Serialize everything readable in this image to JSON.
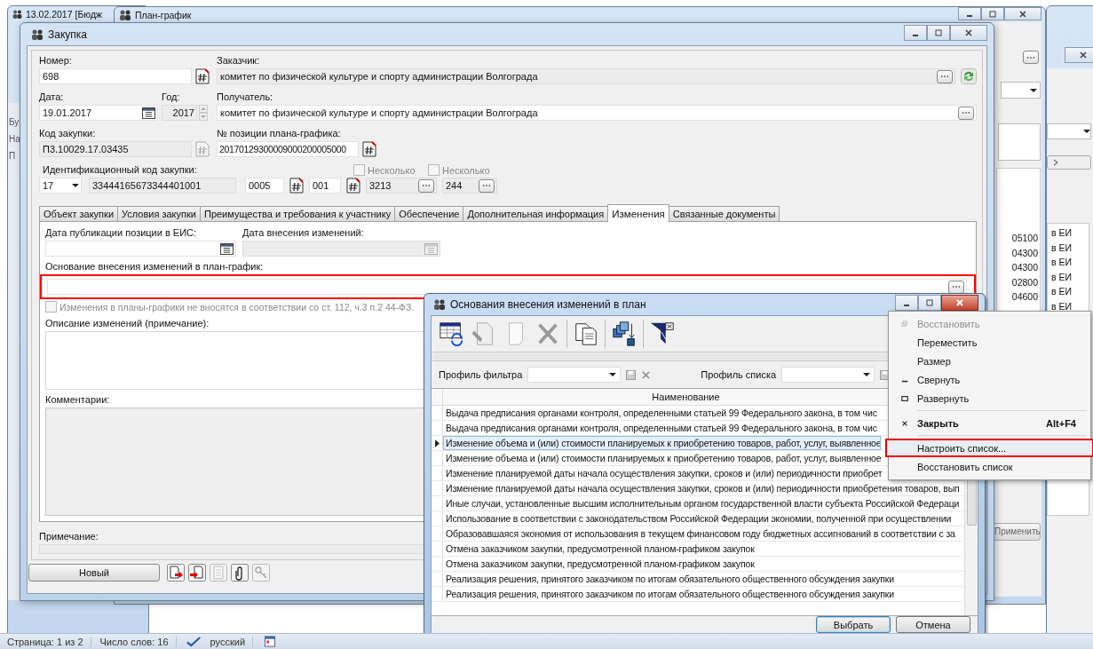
{
  "background": {
    "windows": [
      {
        "title": "13.02.2017 [Бюдж"
      },
      {
        "title": "План-график"
      }
    ],
    "side_labels": [
      "Бу",
      "На",
      "П"
    ],
    "codes": [
      "05100",
      "04300",
      "04300",
      "02800",
      "04600"
    ],
    "eis": [
      "в ЕИ",
      "в ЕИ",
      "в ЕИ",
      "в ЕИ",
      "в ЕИ",
      "в ЕИ"
    ],
    "apply_button": "Применить"
  },
  "main": {
    "title": "Закупка",
    "number": {
      "label": "Номер:",
      "value": "698"
    },
    "customer": {
      "label": "Заказчик:",
      "value": "комитет по физической культуре и спорту администрации Волгограда"
    },
    "date": {
      "label": "Дата:",
      "value": "19.01.2017"
    },
    "year": {
      "label": "Год:",
      "value": "2017"
    },
    "recipient": {
      "label": "Получатель:",
      "value": "комитет по физической культуре и спорту администрации Волгограда"
    },
    "code": {
      "label": "Код закупки:",
      "value": "П3.10029.17.03435"
    },
    "position": {
      "label": "№ позиции плана-графика:",
      "value": "20170129300009000200005000"
    },
    "id_code": {
      "label": "Идентификационный код закупки:",
      "prefix": "17",
      "inn": "33444165673344401001",
      "parts": [
        "0005",
        "001"
      ],
      "several": [
        {
          "label": "Несколько",
          "checked": false,
          "disabled": true,
          "value": "3213"
        },
        {
          "label": "Несколько",
          "checked": false,
          "disabled": true,
          "value": "244"
        }
      ]
    },
    "tabs": [
      {
        "label": "Объект закупки",
        "selected": false
      },
      {
        "label": "Условия закупки",
        "selected": false
      },
      {
        "label": "Преимущества и требования к участнику",
        "selected": false
      },
      {
        "label": "Обеспечение",
        "selected": false
      },
      {
        "label": "Дополнительная информация",
        "selected": false
      },
      {
        "label": "Изменения",
        "selected": true
      },
      {
        "label": "Связанные документы",
        "selected": false
      }
    ],
    "changes": {
      "pub_date_label": "Дата публикации позиции в ЕИС:",
      "change_date_label": "Дата внесения изменений:",
      "basis_label": "Основание внесения изменений в план-график:",
      "basis_highlighted": true,
      "not_applied": {
        "label": "Изменения в планы-графики не вносятся в соответствии со ст. 112, ч.3 п.2 44-ФЗ.",
        "checked": false,
        "disabled": true
      },
      "description_label": "Описание изменений (примечание):",
      "comments_label": "Комментарии:"
    },
    "note_label": "Примечание:",
    "new_button": "Новый"
  },
  "dialog": {
    "title": "Основания внесения изменений в план",
    "filter_profile": "Профиль фильтра",
    "list_profile": "Профиль списка",
    "column": "Наименование",
    "rows": [
      {
        "text": "Выдача предписания органами контроля, определенными статьей 99 Федерального закона, в том чис",
        "selected": false
      },
      {
        "text": "Выдача предписания органами контроля, определенными статьей 99 Федерального закона, в том чис",
        "selected": false
      },
      {
        "text": "Изменение объема и (или) стоимости планируемых к приобретению товаров, работ, услуг, выявленное",
        "selected": true
      },
      {
        "text": "Изменение объема и (или) стоимости планируемых к приобретению товаров, работ, услуг, выявленное",
        "selected": false
      },
      {
        "text": "Изменение планируемой даты начала осуществления закупки, сроков и (или) периодичности приобрет",
        "selected": false
      },
      {
        "text": "Изменение планируемой даты начала осуществления закупки, сроков и (или) периодичности приобретения товаров, вып",
        "selected": false
      },
      {
        "text": "Иные случаи, установленные высшим исполнительным органом государственной власти субъекта Российской Федераци",
        "selected": false
      },
      {
        "text": "Использование в соответствии с законодательством Российской Федерации экономии, полученной при осуществлении",
        "selected": false
      },
      {
        "text": "Образовавшаяся экономия от использования в текущем финансовом году бюджетных ассигнований в соответствии с за",
        "selected": false
      },
      {
        "text": "Отмена заказчиком закупки, предусмотренной планом-графиком закупок",
        "selected": false
      },
      {
        "text": "Отмена заказчиком закупки, предусмотренной планом-графиком закупок",
        "selected": false
      },
      {
        "text": "Реализация решения, принятого заказчиком по итогам обязательного общественного обсуждения закупки",
        "selected": false
      },
      {
        "text": "Реализация решения, принятого заказчиком по итогам обязательного общественного обсуждения закупки",
        "selected": false
      }
    ],
    "buttons": [
      "Выбрать",
      "Отмена"
    ]
  },
  "menu": {
    "items": [
      {
        "kind": "restore",
        "label": "Восстановить",
        "disabled": true,
        "bold": false,
        "highlighted": false
      },
      {
        "kind": "plain",
        "label": "Переместить",
        "disabled": false,
        "bold": false,
        "highlighted": false
      },
      {
        "kind": "plain",
        "label": "Размер",
        "disabled": false,
        "bold": false,
        "highlighted": false
      },
      {
        "kind": "minimize",
        "label": "Свернуть",
        "disabled": false,
        "bold": false,
        "highlighted": false
      },
      {
        "kind": "maximize",
        "label": "Развернуть",
        "disabled": false,
        "bold": false,
        "highlighted": false
      },
      {
        "kind": "separator"
      },
      {
        "kind": "close",
        "label": "Закрыть",
        "shortcut": "Alt+F4",
        "disabled": false,
        "bold": true,
        "highlighted": false
      },
      {
        "kind": "separator"
      },
      {
        "kind": "plain",
        "label": "Настроить список...",
        "disabled": false,
        "bold": false,
        "highlighted": true
      },
      {
        "kind": "plain",
        "label": "Восстановить список",
        "disabled": false,
        "bold": false,
        "highlighted": false
      }
    ]
  },
  "status_bar": {
    "page": "Страница: 1 из 2",
    "words": "Число слов: 16",
    "language": "русский"
  }
}
